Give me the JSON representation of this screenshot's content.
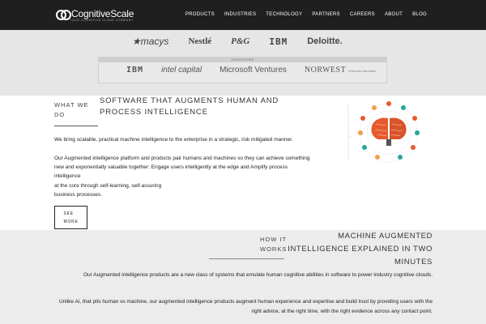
{
  "header": {
    "logo_text": "CognitiveScale",
    "logo_tagline": "YOUR COGNITIVE CLOUD COMPANY",
    "nav": [
      "PRODUCTS",
      "INDUSTRIES",
      "TECHNOLOGY",
      "PARTNERS",
      "CAREERS",
      "ABOUT",
      "BLOG"
    ]
  },
  "clients": {
    "logos": [
      "★macys",
      "Nestlé",
      "P&G",
      "IBM",
      "Deloitte."
    ]
  },
  "investors": {
    "heading": "INVESTORS",
    "ibm": "IBM",
    "intel": "intel capital",
    "microsoft": "Microsoft Ventures",
    "norwest": "NORWEST",
    "norwest_sub": "VENTURE PARTNERS"
  },
  "what_we_do": {
    "label": "WHAT WE DO",
    "title": "SOFTWARE THAT AUGMENTS HUMAN AND PROCESS INTELLIGENCE",
    "intro": "We bring scalable, practical machine intelligence to the enterprise in a strategic, risk mitigated manner.",
    "body_lines": [
      "Our Augmented intelligence platform and products pair humans and machines so they can achieve something",
      "new and exponentially valuable together: Engage users intelligently at the edge and Amplify process",
      "intelligence",
      "at the core through self-learning, self-assuring",
      "business processes."
    ],
    "see_more": "SEE MORE"
  },
  "how_it_works": {
    "label": "HOW IT WORKS",
    "title": "MACHINE AUGMENTED INTELLIGENCE EXPLAINED IN TWO MINUTES",
    "p1": "Our Augmented intelligence products are a new class of systems that emulate human cognitive abilities in software to power industry cognitive clouds.",
    "p2": "Unlike Ai, that pits human vs machine, our augmented intelligence products augment human experience and expertise and build trust by providing users with the right advice, at the right time, with the right evidence across any contact point."
  },
  "colors": {
    "header_bg": "#1f1f1f",
    "band_bg": "#e6e6e6",
    "brain_orange": "#e65a2e",
    "accent_teal": "#2aa59b"
  }
}
